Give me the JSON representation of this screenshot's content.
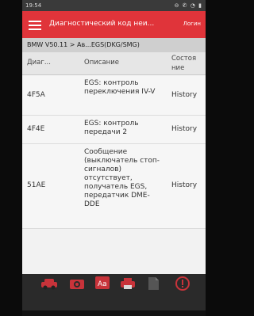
{
  "status_bar": {
    "time": "19:54",
    "icons": "⊖ ✆ ◔ ▮"
  },
  "app_bar": {
    "title": "Диагностический код неи...",
    "login": "Логин"
  },
  "breadcrumb": "BMW V50.11 > Ав...EGS(DKG/SMG)",
  "table": {
    "headers": {
      "code": "Диаг...",
      "description": "Описание",
      "status": "Состоя ние"
    },
    "rows": [
      {
        "code": "4F5A",
        "description": "EGS: контроль переключения IV-V",
        "status": "History"
      },
      {
        "code": "4F4E",
        "description": "EGS: контроль передачи 2",
        "status": "History"
      },
      {
        "code": "51AE",
        "description": "Сообщение (выключатель стоп-сигналов) отсутствует, получатель EGS, передатчик DME-DDE",
        "status": "History"
      }
    ]
  },
  "toolbar": {
    "icons": [
      "car-icon",
      "camera-icon",
      "text-size-icon",
      "print-icon",
      "document-icon",
      "flag-icon",
      "info-icon"
    ]
  },
  "colors": {
    "accent": "#e0343a",
    "row_bg": "#f6f6f6",
    "header_bg": "#e6e6e6"
  }
}
